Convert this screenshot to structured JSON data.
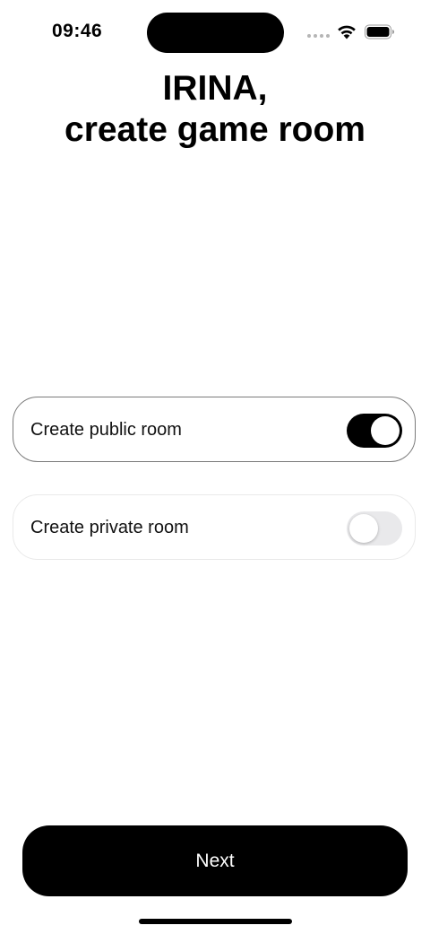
{
  "status_bar": {
    "time": "09:46",
    "icons": [
      "signal-dots-icon",
      "wifi-icon",
      "battery-icon"
    ]
  },
  "heading": {
    "line1": "IRINA,",
    "line2": "create game room"
  },
  "options": [
    {
      "label": "Create public room",
      "toggle": "on"
    },
    {
      "label": "Create private room",
      "toggle": "off"
    }
  ],
  "next_button": {
    "label": "Next"
  },
  "colors": {
    "accent": "#000000",
    "background": "#ffffff",
    "toggle_off": "#e9e9eb"
  }
}
